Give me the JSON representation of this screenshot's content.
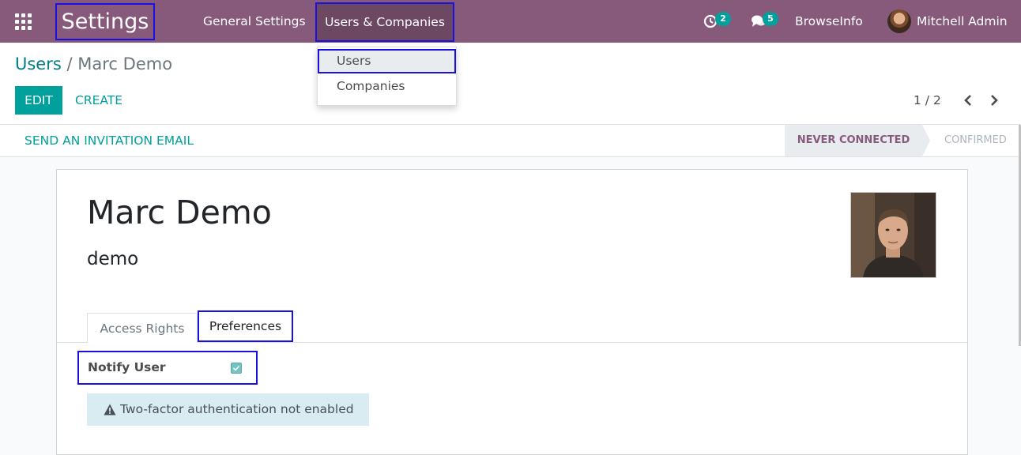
{
  "colors": {
    "navbar": "#875a7b",
    "accent": "#00a09d",
    "highlight_box": "#1a10e0"
  },
  "navbar": {
    "app_title": "Settings",
    "menu": [
      "General Settings",
      "Users & Companies"
    ],
    "activities_badge": "2",
    "messages_badge": "5",
    "company": "BrowseInfo",
    "user": "Mitchell Admin",
    "icons": [
      "apps-grid-icon",
      "activity-clock-icon",
      "chat-bubbles-icon",
      "user-avatar"
    ]
  },
  "dropdown": {
    "items": [
      "Users",
      "Companies"
    ]
  },
  "control_panel": {
    "breadcrumb_parent": "Users",
    "breadcrumb_separator": "/",
    "breadcrumb_current": "Marc Demo",
    "edit_label": "EDIT",
    "create_label": "CREATE",
    "action_partial": "on",
    "pager": "1 / 2"
  },
  "statusbar": {
    "invite_label": "SEND AN INVITATION EMAIL",
    "stages": [
      "NEVER CONNECTED",
      "CONFIRMED"
    ]
  },
  "form": {
    "name": "Marc Demo",
    "login": "demo",
    "tabs": [
      "Access Rights",
      "Preferences"
    ],
    "notify_label": "Notify User",
    "notify_checked": true,
    "tfa_message": "Two-factor authentication not enabled"
  }
}
